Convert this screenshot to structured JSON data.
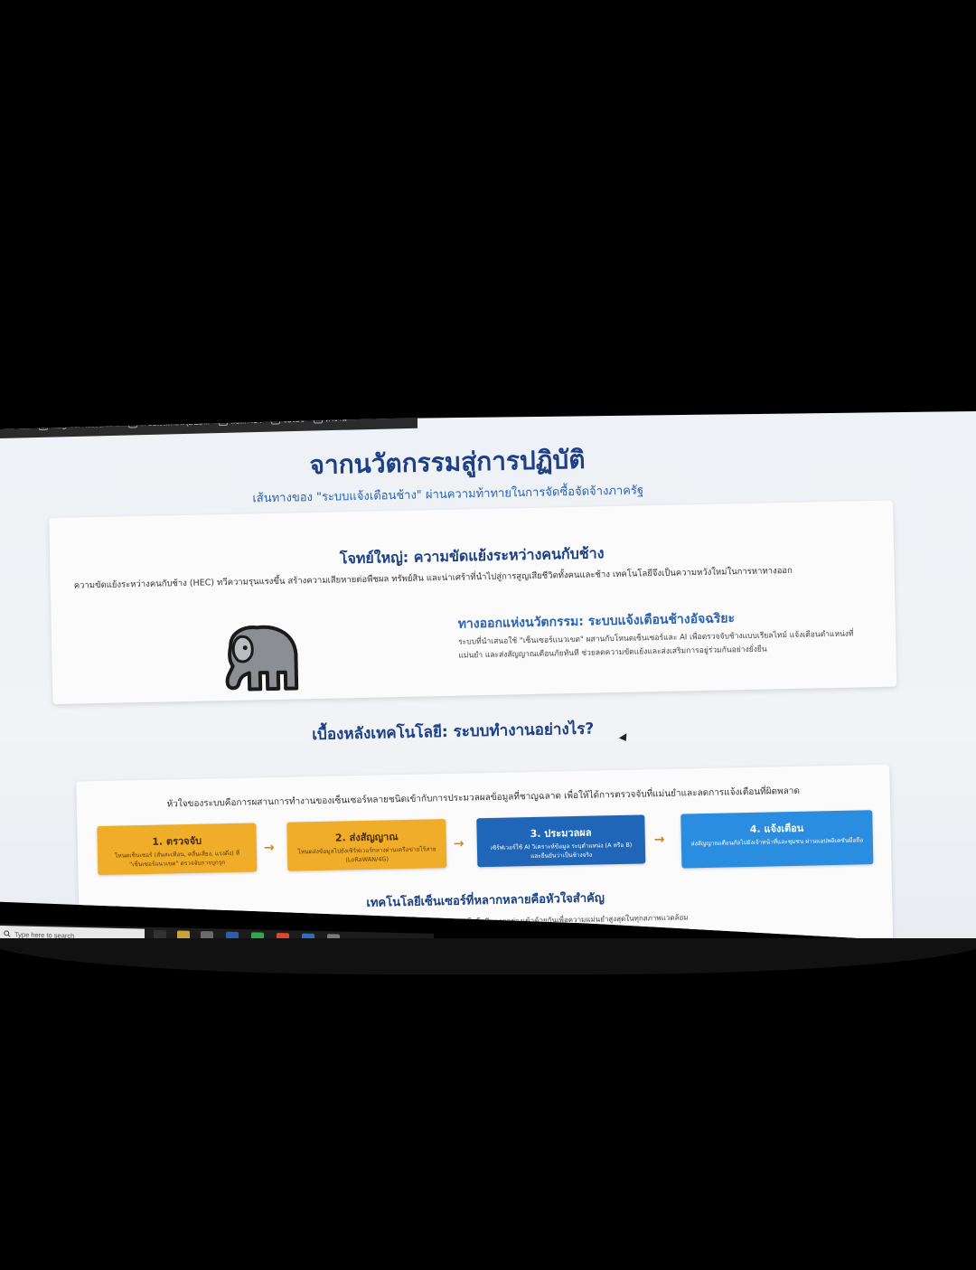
{
  "bookmarks": [
    {
      "label": "YouTube",
      "icon": "youtube-icon"
    },
    {
      "label": "Insightful Resource...",
      "icon": "globe-icon"
    },
    {
      "label": "ระบบเงินเดือน (DED...",
      "icon": "page-icon"
    },
    {
      "label": "แปลภาษา",
      "icon": "translate-icon"
    },
    {
      "label": "จับไอซ",
      "icon": "folder-icon"
    },
    {
      "label": "ทางาน",
      "icon": "folder-icon"
    }
  ],
  "page": {
    "title": "จากนวัตกรรมสู่การปฏิบัติ",
    "subtitle": "เส้นทางของ \"ระบบแจ้งเตือนช้าง\" ผ่านความท้าทายในการจัดซื้อจัดจ้างภาครัฐ"
  },
  "problem": {
    "title": "โจทย์ใหญ่: ความขัดแย้งระหว่างคนกับช้าง",
    "description": "ความขัดแย้งระหว่างคนกับช้าง (HEC) ทวีความรุนแรงขึ้น สร้างความเสียหายต่อพืชผล ทรัพย์สิน และน่าเศร้าที่นำไปสู่การสูญเสียชีวิตทั้งคนและช้าง เทคโนโลยีจึงเป็นความหวังใหม่ในการหาทางออก",
    "solution_title": "ทางออกแห่งนวัตกรรม: ระบบแจ้งเตือนช้างอัจฉริยะ",
    "solution_description": "ระบบที่นำเสนอใช้ \"เซ็นเซอร์แนวเขต\" ผสานกับโหนดเซ็นเซอร์และ AI เพื่อตรวจจับช้างแบบเรียลไทม์ แจ้งเตือนตำแหน่งที่แม่นยำ และส่งสัญญาณเตือนภัยทันที ช่วยลดความขัดแย้งและส่งเสริมการอยู่ร่วมกันอย่างยั่งยืน"
  },
  "tech": {
    "title": "เบื้องหลังเทคโนโลยี: ระบบทำงานอย่างไร?",
    "description": "หัวใจของระบบคือการผสานการทำงานของเซ็นเซอร์หลายชนิดเข้ากับการประมวลผลข้อมูลที่ชาญฉลาด เพื่อให้ได้การตรวจจับที่แม่นยำและลดการแจ้งเตือนที่ผิดพลาด",
    "steps": [
      {
        "title": "1. ตรวจจับ",
        "desc": "โหนดเซ็นเซอร์ (สั่นสะเทือน, คลื่นเสียง, แรงดึง) ที่ \"เซ็นเซอร์แนวเขต\" ตรวจจับการบุกรุก"
      },
      {
        "title": "2. ส่งสัญญาณ",
        "desc": "โหนดส่งข้อมูลไปยังเซิร์ฟเวอร์กลางผ่านเครือข่ายไร้สาย (LoRaWAN/4G)"
      },
      {
        "title": "3. ประมวลผล",
        "desc": "เซิร์ฟเวอร์ใช้ AI วิเคราะห์ข้อมูล ระบุตำแหน่ง (A หรือ B) และยืนยันว่าเป็นช้างจริง"
      },
      {
        "title": "4. แจ้งเตือน",
        "desc": "ส่งสัญญาณเตือนภัยไปยังเจ้าหน้าที่และชุมชน ผ่านแอปพลิเคชันมือถือ"
      }
    ],
    "arrow": "→",
    "sensor_title": "เทคโนโลยีเซ็นเซอร์ที่หลากหลายคือหัวใจสำคัญ",
    "sensor_description": "การพึ่งพาเซ็นเซอร์ชนิดเดียวไม่เพียงพอ ระบบจึงต้องรวมเทคโนโลยีหลายอย่างเข้าด้วยกันเพื่อความแม่นยำสูงสุดในทุกสภาพแวดล้อม"
  },
  "taskbar": {
    "search_placeholder": "Type here to search"
  },
  "colors": {
    "heading": "#1c3f86",
    "accent_blue": "#2b63b6",
    "step_orange": "#f0ad2a",
    "step_blue_dark": "#1f66b8",
    "step_blue_light": "#2a8de0"
  }
}
